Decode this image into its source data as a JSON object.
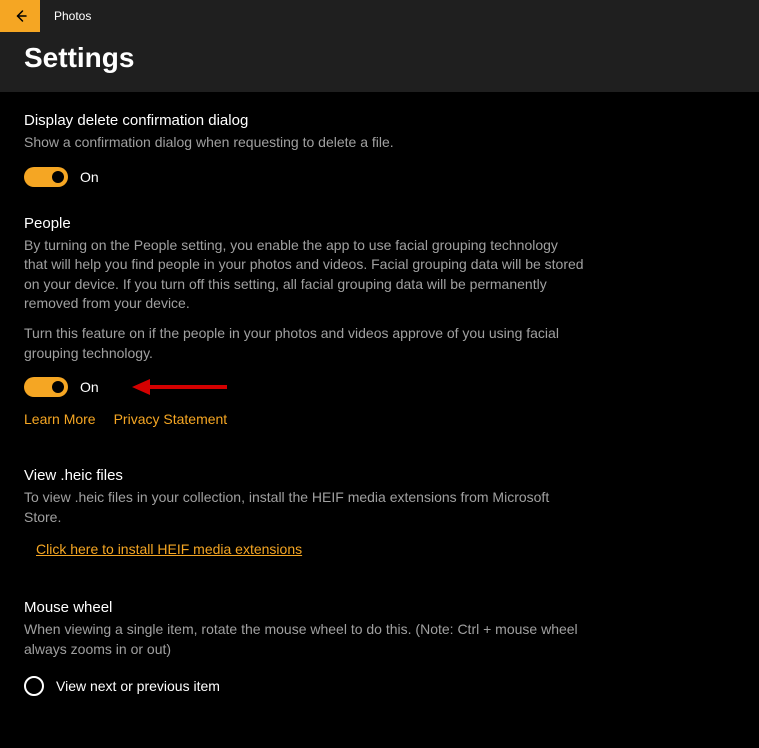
{
  "app": {
    "name": "Photos"
  },
  "page": {
    "title": "Settings"
  },
  "sections": {
    "deleteDialog": {
      "title": "Display delete confirmation dialog",
      "desc": "Show a confirmation dialog when requesting to delete a file.",
      "toggleState": "On"
    },
    "people": {
      "title": "People",
      "desc": "By turning on the People setting, you enable the app to use facial grouping technology that will help you find people in your photos and videos. Facial grouping data will be stored on your device. If you turn off this setting, all facial grouping data will be permanently removed from your device.",
      "desc2": "Turn this feature on if the people in your photos and videos approve of you using facial grouping technology.",
      "toggleState": "On",
      "learnMore": "Learn More",
      "privacy": "Privacy Statement"
    },
    "heic": {
      "title": "View .heic files",
      "desc": "To view .heic files in your collection, install the HEIF media extensions from Microsoft Store.",
      "link": "Click here to install HEIF media extensions"
    },
    "mouseWheel": {
      "title": "Mouse wheel",
      "desc": "When viewing a single item, rotate the mouse wheel to do this. (Note: Ctrl + mouse wheel always zooms in or out)",
      "option1": "View next or previous item"
    }
  }
}
